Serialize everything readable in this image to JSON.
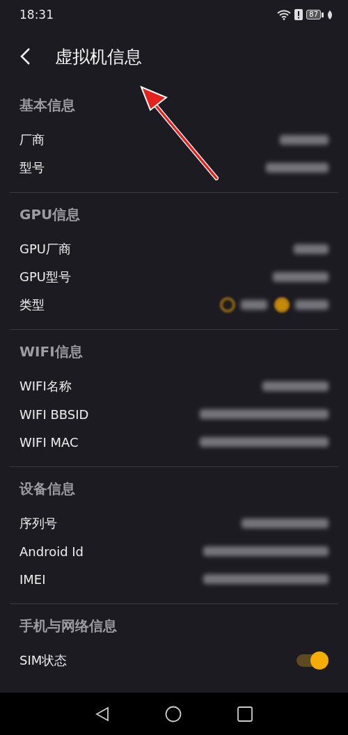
{
  "status_bar": {
    "time": "18:31",
    "battery": "87"
  },
  "header": {
    "title": "虚拟机信息"
  },
  "sections": [
    {
      "title": "基本信息",
      "rows": [
        {
          "kind": "redacted",
          "label": "厂商"
        },
        {
          "kind": "redacted",
          "label": "型号"
        }
      ]
    },
    {
      "title": "GPU信息",
      "rows": [
        {
          "kind": "redacted",
          "label": "GPU厂商"
        },
        {
          "kind": "redacted",
          "label": "GPU型号"
        },
        {
          "kind": "radio",
          "label": "类型",
          "options": [
            {
              "selected": false
            },
            {
              "selected": true
            }
          ]
        }
      ]
    },
    {
      "title": "WIFI信息",
      "rows": [
        {
          "kind": "redacted",
          "label": "WIFI名称"
        },
        {
          "kind": "redacted",
          "label": "WIFI BBSID"
        },
        {
          "kind": "redacted",
          "label": "WIFI MAC"
        }
      ]
    },
    {
      "title": "设备信息",
      "rows": [
        {
          "kind": "redacted",
          "label": "序列号"
        },
        {
          "kind": "redacted",
          "label": "Android Id"
        },
        {
          "kind": "redacted",
          "label": "IMEI"
        }
      ]
    },
    {
      "title": "手机与网络信息",
      "rows": [
        {
          "kind": "toggle",
          "label": "SIM状态",
          "on": true
        }
      ]
    }
  ]
}
